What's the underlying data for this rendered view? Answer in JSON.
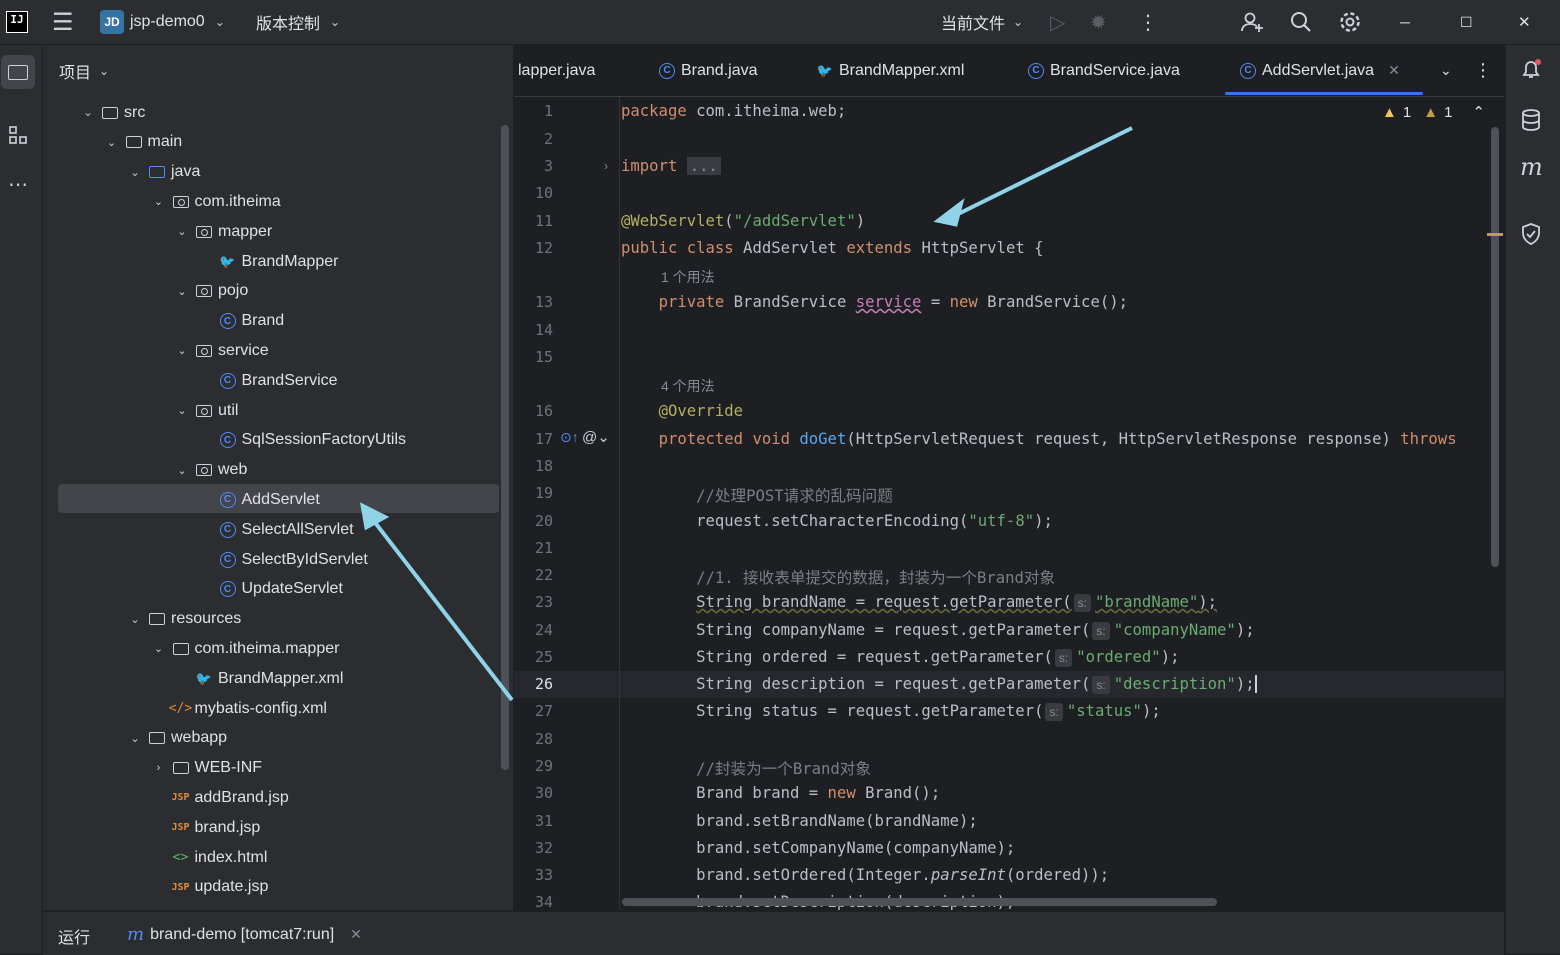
{
  "titlebar": {
    "logo_text": "IJ",
    "project_badge": "JD",
    "project_name": "jsp-demo0",
    "vcs_label": "版本控制",
    "run_config": "当前文件",
    "window_buttons": [
      "─",
      "☐",
      "✕"
    ]
  },
  "project_panel": {
    "title": "项目",
    "tree": [
      {
        "label": "src",
        "icon": "folder",
        "expanded": true
      },
      {
        "label": "main",
        "icon": "folder",
        "expanded": true
      },
      {
        "label": "java",
        "icon": "folder-source",
        "expanded": true
      },
      {
        "label": "com.itheima",
        "icon": "package",
        "expanded": true
      },
      {
        "label": "mapper",
        "icon": "package",
        "expanded": true
      },
      {
        "label": "BrandMapper",
        "icon": "mybatis-mapper"
      },
      {
        "label": "pojo",
        "icon": "package",
        "expanded": true
      },
      {
        "label": "Brand",
        "icon": "class"
      },
      {
        "label": "service",
        "icon": "package",
        "expanded": true
      },
      {
        "label": "BrandService",
        "icon": "class"
      },
      {
        "label": "util",
        "icon": "package",
        "expanded": true
      },
      {
        "label": "SqlSessionFactoryUtils",
        "icon": "class"
      },
      {
        "label": "web",
        "icon": "package",
        "expanded": true
      },
      {
        "label": "AddServlet",
        "icon": "class",
        "selected": true
      },
      {
        "label": "SelectAllServlet",
        "icon": "class"
      },
      {
        "label": "SelectByIdServlet",
        "icon": "class"
      },
      {
        "label": "UpdateServlet",
        "icon": "class"
      },
      {
        "label": "resources",
        "icon": "folder-resources",
        "expanded": true
      },
      {
        "label": "com.itheima.mapper",
        "icon": "folder",
        "expanded": true
      },
      {
        "label": "BrandMapper.xml",
        "icon": "mybatis-xml"
      },
      {
        "label": "mybatis-config.xml",
        "icon": "xml"
      },
      {
        "label": "webapp",
        "icon": "folder-web",
        "expanded": true
      },
      {
        "label": "WEB-INF",
        "icon": "folder",
        "expanded": false
      },
      {
        "label": "addBrand.jsp",
        "icon": "jsp"
      },
      {
        "label": "brand.jsp",
        "icon": "jsp"
      },
      {
        "label": "index.html",
        "icon": "html"
      },
      {
        "label": "update.jsp",
        "icon": "jsp"
      }
    ]
  },
  "tabs": [
    {
      "label": "lapper.java",
      "icon": "class"
    },
    {
      "label": "Brand.java",
      "icon": "class"
    },
    {
      "label": "BrandMapper.xml",
      "icon": "mybatis-xml"
    },
    {
      "label": "BrandService.java",
      "icon": "class"
    },
    {
      "label": "AddServlet.java",
      "icon": "class",
      "active": true
    }
  ],
  "inspections": {
    "warnings": "1",
    "weak_warnings": "1"
  },
  "editor": {
    "line_numbers": [
      "1",
      "2",
      "3",
      "10",
      "11",
      "12",
      "13",
      "14",
      "15",
      "16",
      "17",
      "18",
      "19",
      "20",
      "21",
      "22",
      "23",
      "24",
      "25",
      "26",
      "27",
      "28",
      "29",
      "30",
      "31",
      "32",
      "33",
      "34"
    ],
    "current_line": "26",
    "usage_hint_1": "1 个用法",
    "usage_hint_2": "4 个用法",
    "param_hint": "s:"
  },
  "statusbar": {
    "run_label": "运行",
    "run_config": "brand-demo [tomcat7:run]"
  },
  "colors": {
    "accent": "#3574f0",
    "annotation_arrow": "#8fd3e8",
    "selection": "#43454a"
  }
}
